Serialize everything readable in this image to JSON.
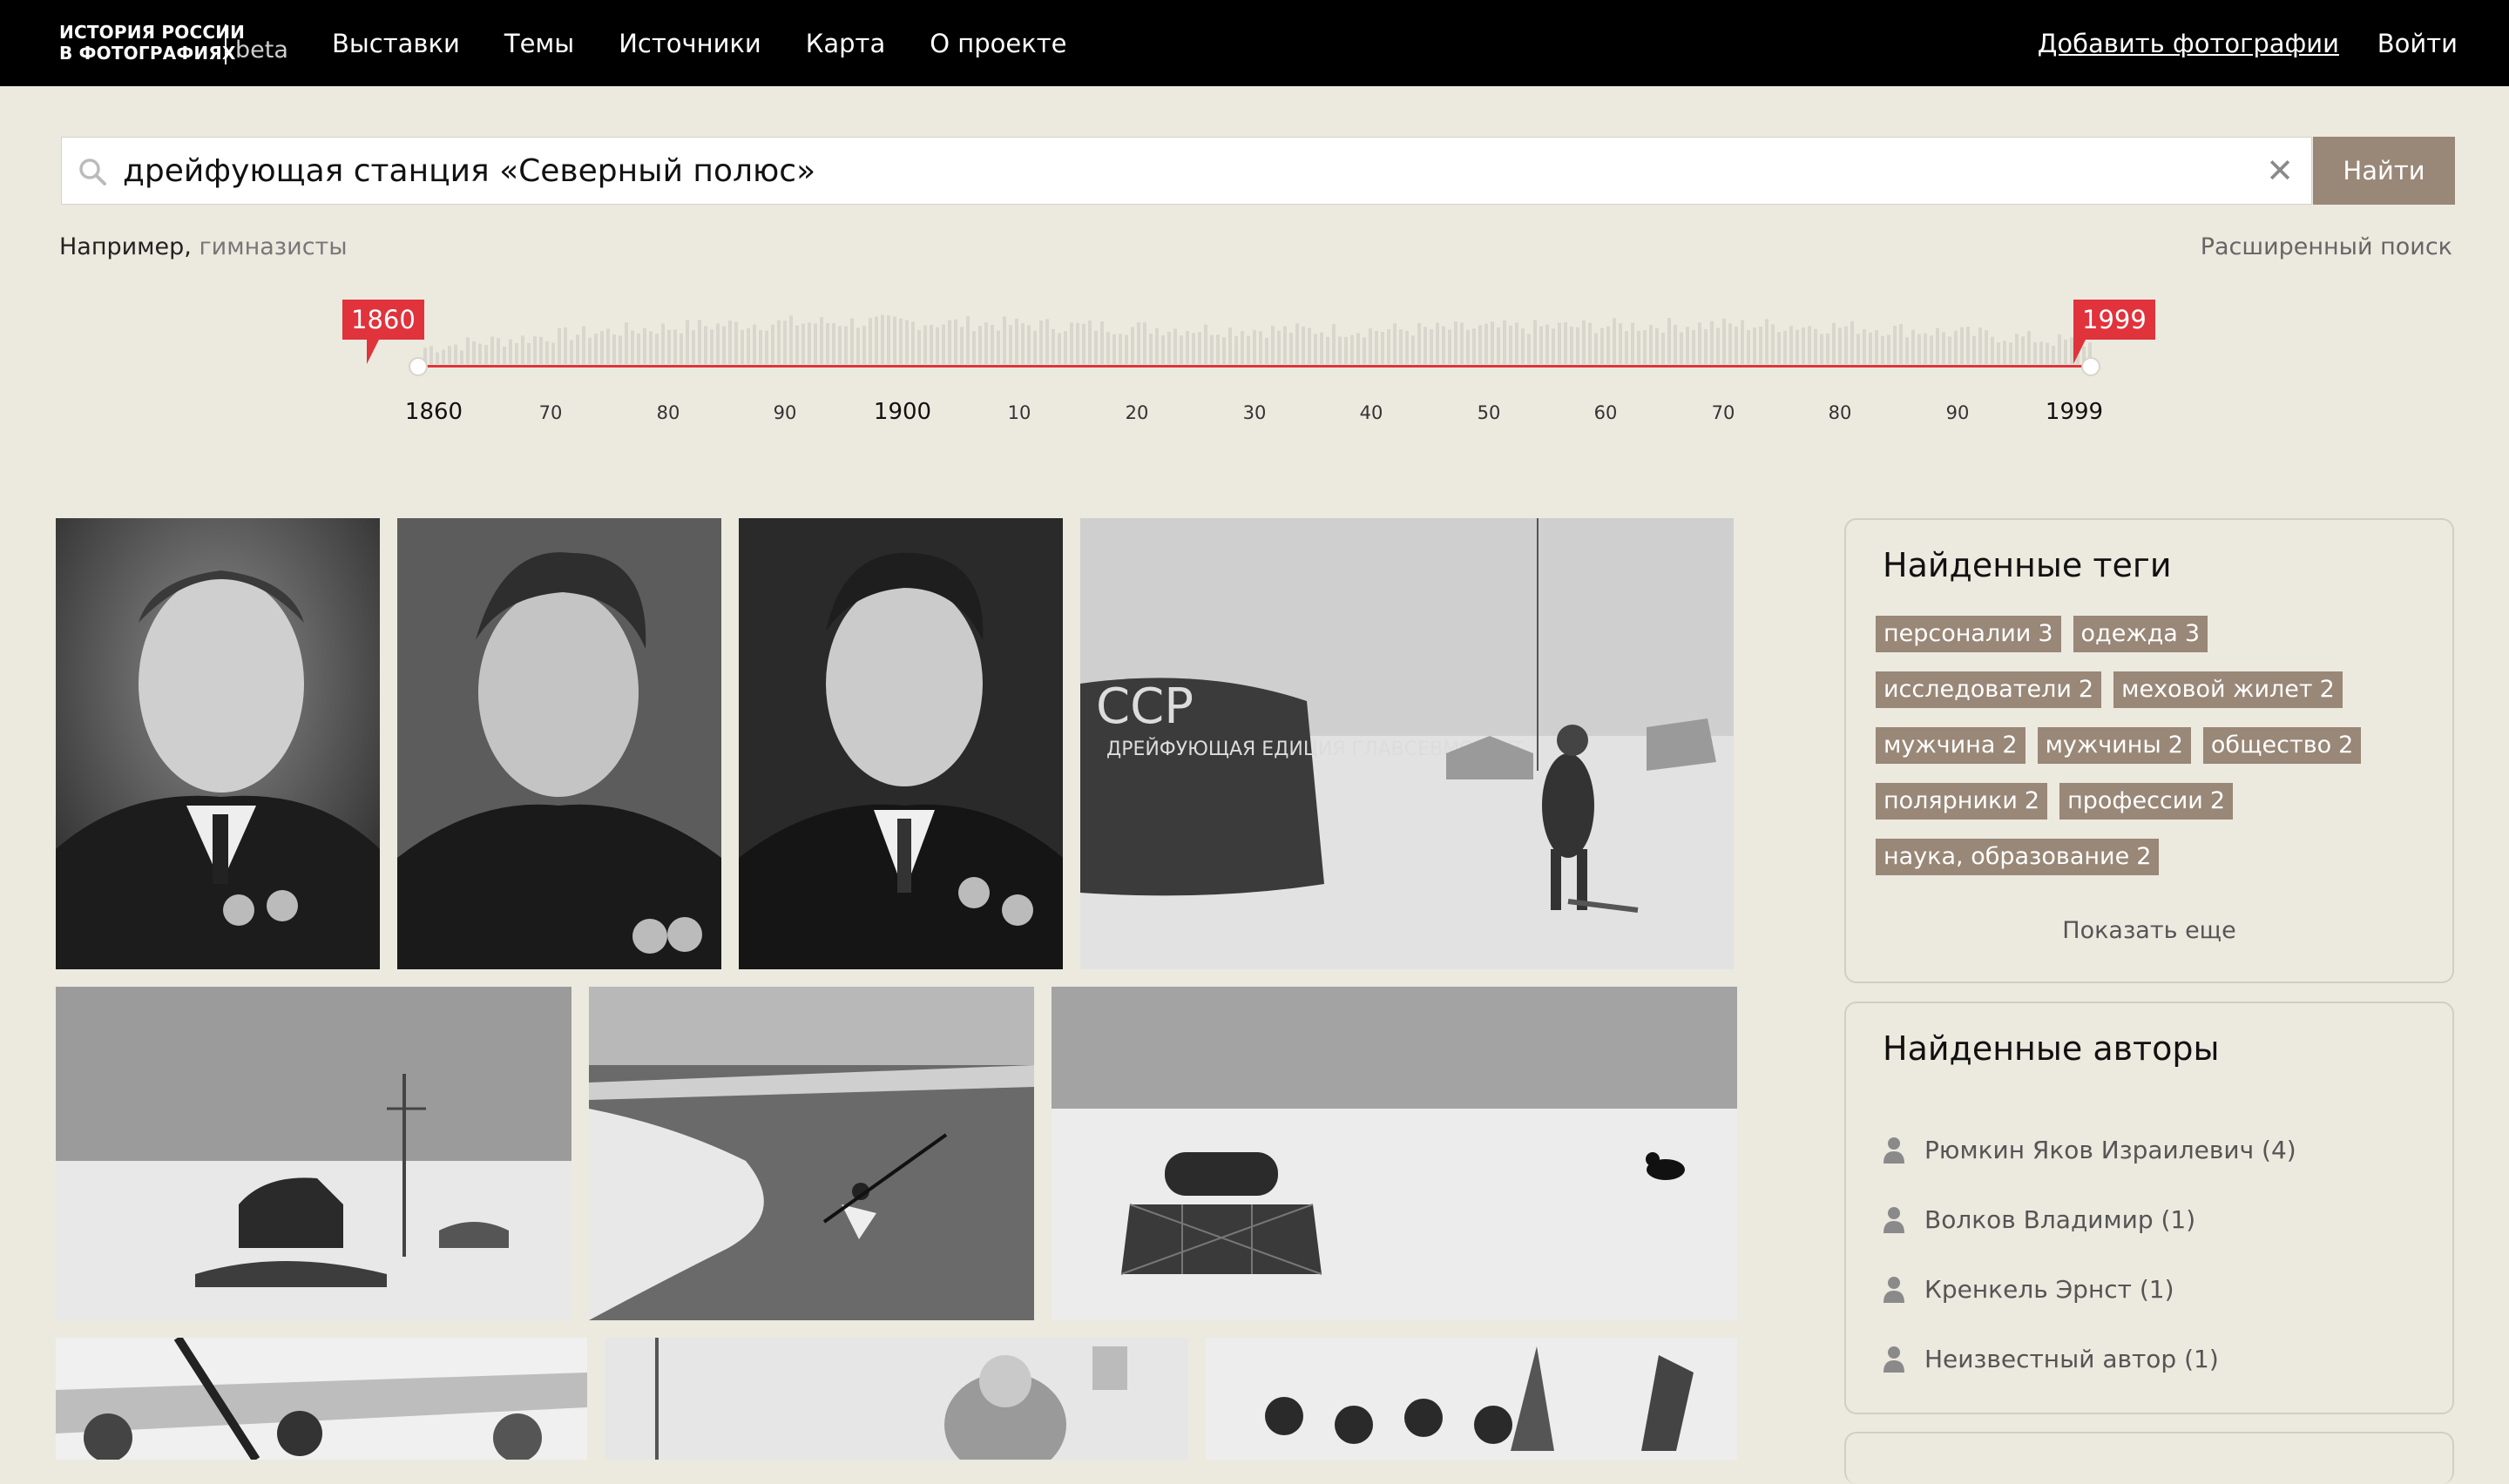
{
  "header": {
    "logo_line1": "ИСТОРИЯ РОССИИ",
    "logo_line2": "В ФОТОГРАФИЯХ",
    "logo_beta": "beta",
    "nav": [
      "Выставки",
      "Темы",
      "Источники",
      "Карта",
      "О проекте"
    ],
    "add_photos": "Добавить фотографии",
    "login": "Войти"
  },
  "search": {
    "value": "дрейфующая станция «Северный полюс»",
    "button": "Найти",
    "example_prefix": "Например,",
    "example_link": "гимназисты",
    "advanced": "Расширенный поиск",
    "icon": "search-icon",
    "clear_icon": "close-icon"
  },
  "timeline": {
    "from": "1860",
    "to": "1999",
    "ticks": [
      "1860",
      "70",
      "80",
      "90",
      "1900",
      "10",
      "20",
      "30",
      "40",
      "50",
      "60",
      "70",
      "80",
      "90",
      "1999"
    ],
    "accent_color": "#e0333c"
  },
  "photos": [
    {
      "name": "photo-portrait-1"
    },
    {
      "name": "photo-portrait-2"
    },
    {
      "name": "photo-portrait-3"
    },
    {
      "name": "photo-tent-camp",
      "text": "ДРЕЙФУЮЩАЯ ЕДИЦИЯ ГЛАВСЕВМОРПУТ"
    },
    {
      "name": "photo-camp-mast"
    },
    {
      "name": "photo-kayak"
    },
    {
      "name": "photo-ice-dog"
    },
    {
      "name": "photo-airplane"
    },
    {
      "name": "photo-man-writing"
    },
    {
      "name": "photo-flags"
    }
  ],
  "tags_panel": {
    "title": "Найденные теги",
    "rows": [
      [
        {
          "label": "персоналии",
          "count": "3"
        },
        {
          "label": "одежда",
          "count": "3"
        }
      ],
      [
        {
          "label": "исследователи",
          "count": "2"
        },
        {
          "label": "меховой жилет",
          "count": "2"
        }
      ],
      [
        {
          "label": "мужчина",
          "count": "2"
        },
        {
          "label": "мужчины",
          "count": "2"
        },
        {
          "label": "общество",
          "count": "2"
        }
      ],
      [
        {
          "label": "полярники",
          "count": "2"
        },
        {
          "label": "профессии",
          "count": "2"
        }
      ],
      [
        {
          "label": "наука, образование",
          "count": "2"
        }
      ]
    ],
    "show_more": "Показать еще",
    "tag_color": "#998777"
  },
  "authors_panel": {
    "title": "Найденные авторы",
    "authors": [
      "Рюмкин Яков Израилевич (4)",
      "Волков Владимир (1)",
      "Кренкель Эрнст (1)",
      "Неизвестный автор (1)"
    ],
    "icon": "person-icon"
  }
}
